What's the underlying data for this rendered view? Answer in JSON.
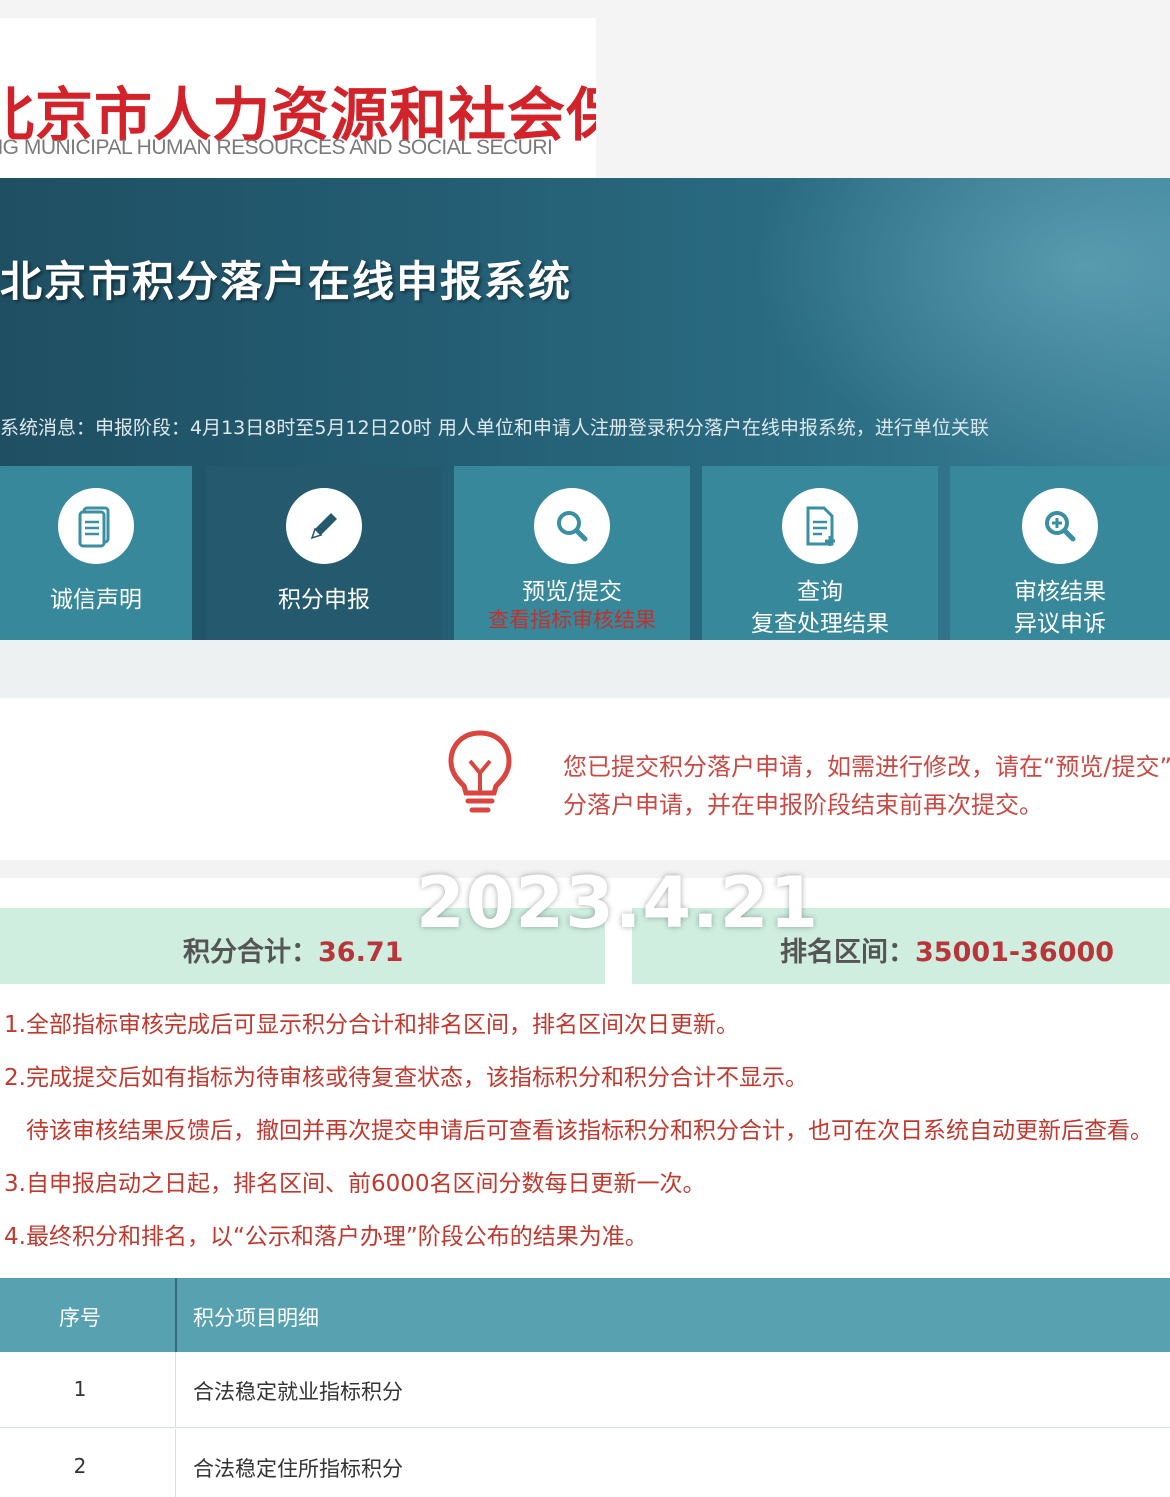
{
  "header": {
    "logo_cn": "北京市人力资源和社会保",
    "logo_en": "NG MUNICIPAL HUMAN RESOURCES AND SOCIAL SECURI"
  },
  "banner": {
    "title": "北京市积分落户在线申报系统",
    "message": "系统消息：申报阶段：4月13日8时至5月12日20时 用人单位和申请人注册登录积分落户在线申报系统，进行单位关联"
  },
  "nav": [
    {
      "label": "诚信声明",
      "sub": "",
      "icon": "document-icon",
      "active": false
    },
    {
      "label": "积分申报",
      "sub": "",
      "icon": "pencil-icon",
      "active": true
    },
    {
      "label": "预览/提交",
      "sub": "查看指标审核结果",
      "icon": "search-icon",
      "active": false
    },
    {
      "label": "查询",
      "sub": "复查处理结果",
      "icon": "file-plus-icon",
      "active": false
    },
    {
      "label": "审核结果",
      "sub": "异议申诉",
      "icon": "zoom-in-icon",
      "active": false
    }
  ],
  "notice": {
    "line1": "您已提交积分落户申请，如需进行修改，请在“预览/提交”中撤回积",
    "line2": "分落户申请，并在申报阶段结束前再次提交。"
  },
  "date_stamp": "2023.4.21",
  "score": {
    "total_label": "积分合计：",
    "total_value": "36.71",
    "rank_label": "排名区间：",
    "rank_value": "35001-36000"
  },
  "notes": [
    "1.全部指标审核完成后可显示积分合计和排名区间，排名区间次日更新。",
    "2.完成提交后如有指标为待审核或待复查状态，该指标积分和积分合计不显示。",
    "待该审核结果反馈后，撤回并再次提交申请后可查看该指标积分和积分合计，也可在次日系统自动更新后查看。",
    "3.自申报启动之日起，排名区间、前6000名区间分数每日更新一次。",
    "4.最终积分和排名，以“公示和落户办理”阶段公布的结果为准。"
  ],
  "table": {
    "headers": [
      "序号",
      "积分项目明细"
    ],
    "rows": [
      {
        "no": "1",
        "name": "合法稳定就业指标积分"
      },
      {
        "no": "2",
        "name": "合法稳定住所指标积分"
      }
    ]
  },
  "colors": {
    "brand_red": "#d2232a",
    "banner_teal": "#245e74",
    "tile_teal": "#38889c",
    "score_green": "#cfeee0"
  }
}
